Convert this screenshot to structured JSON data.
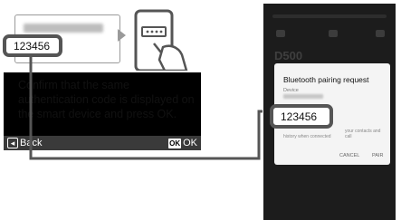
{
  "camera": {
    "instruction_text": "Confirm that the same authentication code is displayed on the smart device and press OK.",
    "passkey": "123456",
    "back_label": "Back",
    "back_icon": "multi-selector-icon",
    "ok_label": "OK",
    "ok_icon_text": "OK"
  },
  "phone": {
    "dialog_title": "Bluetooth pairing request",
    "device_label": "Device",
    "passkey": "123456",
    "contacts_hint": "your contacts and call",
    "history_hint": "history when connected",
    "background_text": "D500",
    "cancel_label": "CANCEL",
    "pair_label": "PAIR"
  },
  "colors": {
    "callout_border": "#555555",
    "camera_bg": "#000000",
    "phone_bg": "#1c1c1c"
  }
}
